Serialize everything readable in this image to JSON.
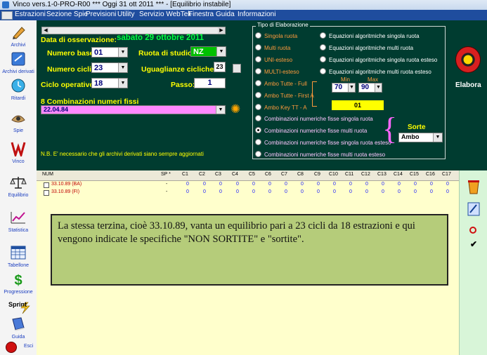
{
  "window": {
    "title": "Vinco vers.1-0-PRO-R00  ***  Oggi 31 ott 2011  ***  - [Equilibrio instabile]"
  },
  "menu": [
    "Estrazioni",
    "Sezione Spie",
    "Previsioni",
    "Utility",
    "Servizio WebTek",
    "Finestra",
    "Guida",
    "Informazioni"
  ],
  "leftbar": {
    "items": [
      {
        "label": "Archivi",
        "icon": "pencil-icon"
      },
      {
        "label": "Archivi derivati",
        "icon": "archive-icon"
      },
      {
        "label": "Ritardi",
        "icon": "clock-icon"
      },
      {
        "label": "Spie",
        "icon": "spy-icon"
      },
      {
        "label": "Vinco",
        "icon": "vinco-icon"
      },
      {
        "label": "Equilibrio",
        "icon": "scale-icon"
      },
      {
        "label": "Statistica",
        "icon": "chart-icon"
      },
      {
        "label": "Tabellone",
        "icon": "calendar-icon"
      },
      {
        "label": "Progressione",
        "icon": "dollar-icon"
      },
      {
        "label": "Sprint",
        "icon": "sprint-icon"
      },
      {
        "label": "Guida",
        "icon": "book-icon"
      },
      {
        "label": "Esci",
        "icon": "exit-icon"
      }
    ]
  },
  "form": {
    "data_label": "Data di osservazione:",
    "data_value": "sabato 29 ottobre 2011",
    "numero_base_label": "Numero base:",
    "numero_base_value": "01",
    "ruota_label": "Ruota di studio:",
    "ruota_value": "NZ",
    "numero_cicli_label": "Numero cicli:",
    "numero_cicli_value": "23",
    "uguaglianze_label": "Uguaglianze cicliche:",
    "uguaglianze_value": "23",
    "ciclo_label": "Ciclo operativo:",
    "ciclo_value": "18",
    "passo_label": "Passo:",
    "passo_value": "1",
    "comb_label": "8 Combinazioni numeri fissi",
    "comb_value": "22.04.84",
    "nb_text": "N.B. E' necessario che gli archivi derivati siano sempre aggiornati"
  },
  "elaborazione": {
    "legend": "Tipo di Elaborazione",
    "left_options": [
      "Singola ruota",
      "Multi ruota",
      "UNI-esteso",
      "MULTI-esteso",
      "Ambo Tutte - Full",
      "Ambo Tutte - First A",
      "Ambo Key TT -  A"
    ],
    "right_options": [
      "Equazioni algoritmiche singola ruota",
      "Equazioni algoritmiche multi ruota",
      "Equazioni algoritmiche singola ruota esteso",
      "Equazioni algoritmiche multi ruota esteso"
    ],
    "comb_options": [
      "Combinazioni numeriche fisse singola ruota",
      "Combinazioni numeriche fisse multi ruota",
      "Combinazioni numeriche fisse singola ruota esteso",
      "Combinazioni numeriche fisse multi ruota esteso"
    ],
    "selected_comb": 1,
    "min_label": "Min",
    "max_label": "Max",
    "min_value": "70",
    "max_value": "90",
    "key_value": "01",
    "sorte_label": "Sorte",
    "sorte_value": "Ambo",
    "elabora_label": "Elabora",
    "colors": {
      "panel": "#003c30",
      "label": "#ffff00",
      "orange": "#ff9a3c",
      "key": "#ffff00"
    }
  },
  "grid": {
    "headers": [
      "NUM",
      "SP *",
      "C1",
      "C2",
      "C3",
      "C4",
      "C5",
      "C6",
      "C7",
      "C8",
      "C9",
      "C10",
      "C11",
      "C12",
      "C13",
      "C14",
      "C15",
      "C16",
      "C17"
    ],
    "rows": [
      {
        "num": "33.10.89  (BA)",
        "sp": "-",
        "vals": [
          "0",
          "0",
          "0",
          "0",
          "0",
          "0",
          "0",
          "0",
          "0",
          "0",
          "0",
          "0",
          "0",
          "0",
          "0",
          "0",
          "0"
        ]
      },
      {
        "num": "33.10.89  (FI)",
        "sp": "-",
        "vals": [
          "0",
          "0",
          "0",
          "0",
          "0",
          "0",
          "0",
          "0",
          "0",
          "0",
          "0",
          "0",
          "0",
          "0",
          "0",
          "0",
          "0"
        ]
      }
    ]
  },
  "callout": {
    "text": "La stessa terzina, cioè 33.10.89, vanta un equilibrio pari a 23 cicli da 18 estrazioni e qui vengono indicate le specifiche \"NON SORTITE\" e \"sortite\"."
  },
  "rightbar": {
    "icons": [
      "bucket-icon",
      "edit-icon",
      "no-icon",
      "check-icon"
    ]
  }
}
